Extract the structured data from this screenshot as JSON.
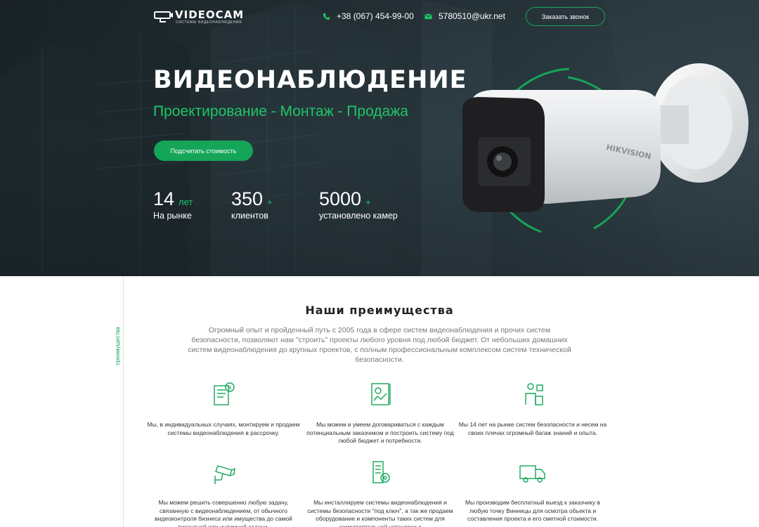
{
  "header": {
    "logo_name": "VIDEOCAM",
    "logo_tagline": "СИСТЕМЫ ВИДЕОНАБЛЮДЕНИЯ",
    "phone": "+38 (067) 454-99-00",
    "email": "5780510@ukr.net",
    "call_button": "Заказать звонок"
  },
  "hero": {
    "title": "ВИДЕОНАБЛЮДЕНИЕ",
    "subtitle": "Проектирование - Монтаж - Продажа",
    "cta_button": "Подсчитать стоимость",
    "camera_brand": "HIKVISION",
    "stats": [
      {
        "value": "14",
        "suffix": "лет",
        "label": "На рынке"
      },
      {
        "value": "350",
        "suffix": "+",
        "label": "клиентов"
      },
      {
        "value": "5000",
        "suffix": "+",
        "label": "установлено камер"
      }
    ]
  },
  "advantages": {
    "side_label": "преимущества",
    "title": "Наши преимущества",
    "description": "Огромный опыт и пройденный путь с 2005 года в сфере систем видеонаблюдения и прочих систем безопасности, позволяют нам \"строить\" проекты любого уровня под любой бюджет. От небольших домашних систем видеонаблюдения до крупных проектов, с полным профессиональным комплексом систем технической безопасности.",
    "items": [
      {
        "icon": "installment-document-icon",
        "text": "Мы, в индивидуальных случаях, монтируем и продаем системы видеонаблюдения в рассрочку."
      },
      {
        "icon": "budget-chart-icon",
        "text": "Мы можем и умеем договариваться с каждым потенциальным заказчиком и построить систему под любой бюджет и потребности."
      },
      {
        "icon": "experience-person-icon",
        "text": "Мы 14 лет на рынке систем безопасности и несем на своих плечах огромный багаж знаний и опыта."
      },
      {
        "icon": "cctv-camera-icon",
        "text": "Мы можем решить совершенно любую задачу, связанную с видеонаблюдением, от обычного видеоконтроля бизнеса или имущества до самой пикантной или интимной задачи."
      },
      {
        "icon": "turnkey-server-icon",
        "text": "Мы инсталлируем системы видеонаблюдения и системы безопасности \"под ключ\", а так же продаем оборудование и компоненты таких систем для самостоятельной установки с"
      },
      {
        "icon": "delivery-truck-icon",
        "text": "Мы производим бесплатный выезд к заказчику в любую точку Винницы для осмотра обьекта и составления проекта и его сметной стоимости."
      }
    ]
  },
  "colors": {
    "accent": "#14a558",
    "accent_light": "#1dc767",
    "hero_bg": "#26343a"
  }
}
